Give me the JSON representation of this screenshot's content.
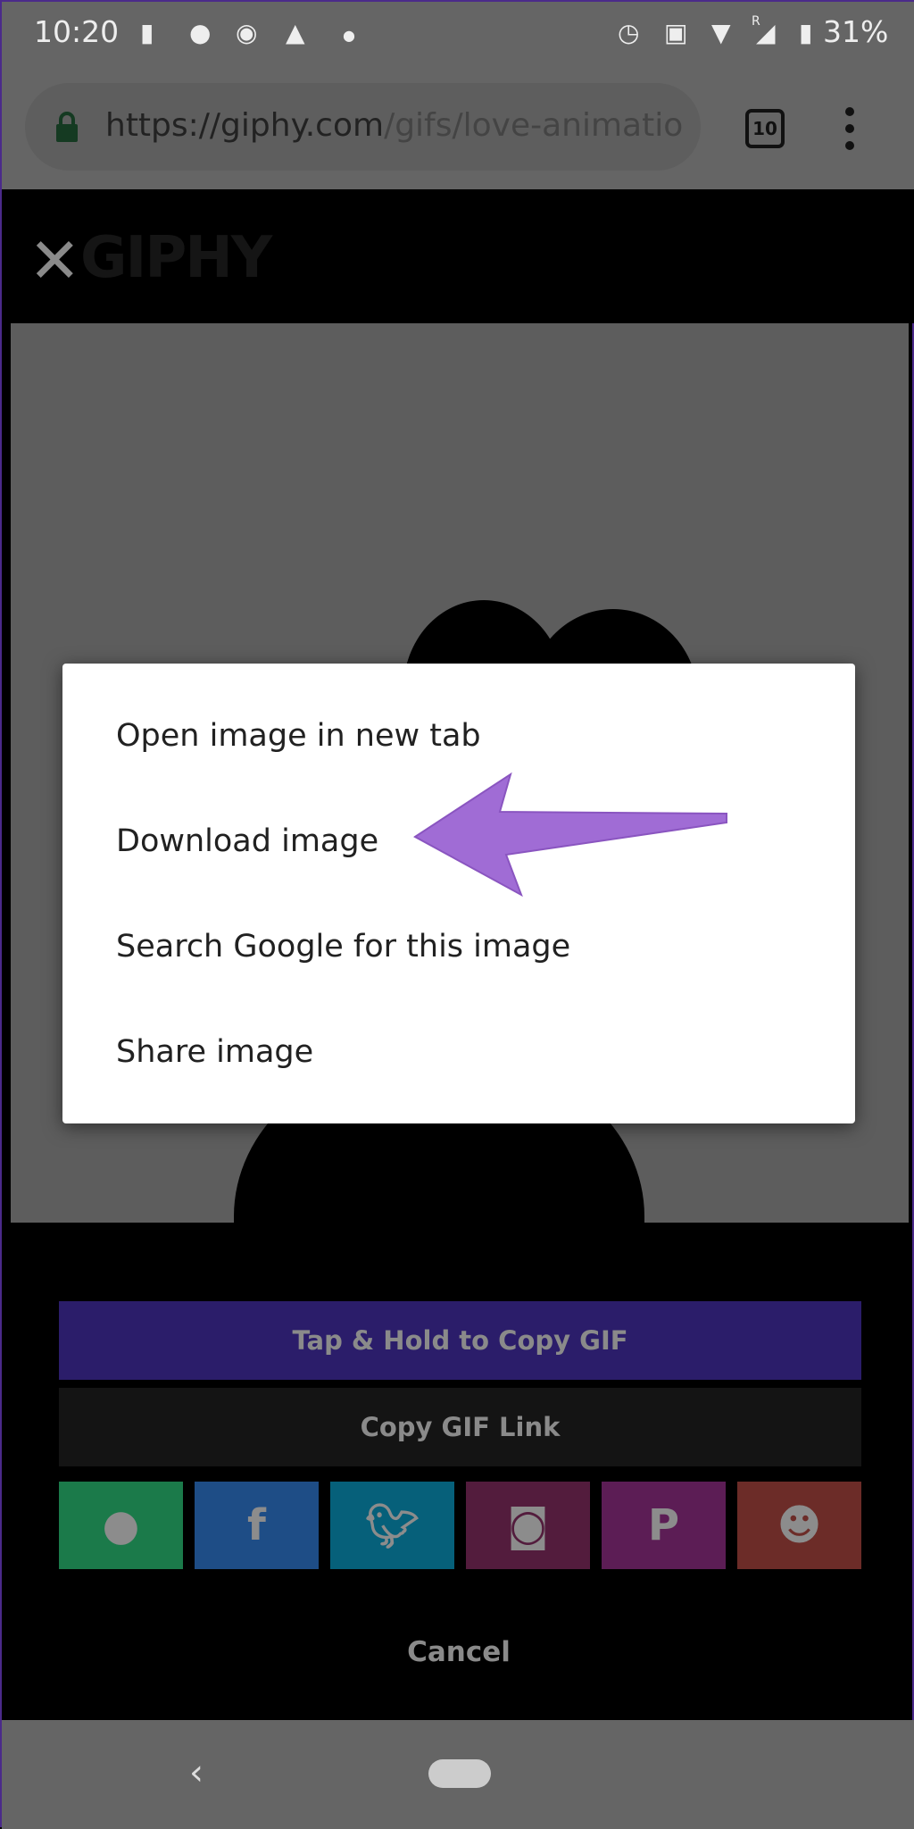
{
  "status_bar": {
    "time": "10:20",
    "battery": "31%",
    "roaming": "R"
  },
  "browser": {
    "url_host": "https://giphy.com",
    "url_path": "/gifs/love-animatio",
    "tab_count": "10"
  },
  "site": {
    "logo": "GIPHY"
  },
  "context_menu": {
    "items": [
      "Open image in new tab",
      "Download image",
      "Search Google for this image",
      "Share image"
    ]
  },
  "arrow_color": "#a06cd5",
  "share_sheet": {
    "copy_gif": "Tap & Hold to Copy GIF",
    "copy_link": "Copy GIF Link",
    "cancel": "Cancel",
    "tiles": [
      {
        "name": "message",
        "color": "#1b7a4a"
      },
      {
        "name": "facebook",
        "color": "#1e4d86"
      },
      {
        "name": "twitter",
        "color": "#06607a"
      },
      {
        "name": "instagram",
        "color": "#531c3d"
      },
      {
        "name": "pinterest",
        "color": "#5c1d55"
      },
      {
        "name": "reddit",
        "color": "#6c2c28"
      }
    ]
  }
}
